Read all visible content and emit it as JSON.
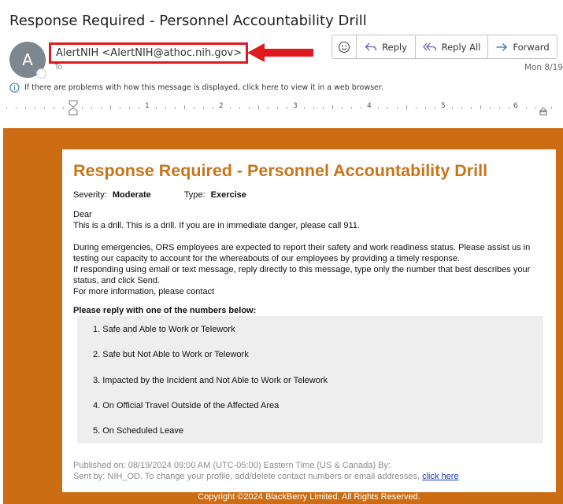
{
  "message": {
    "subject": "Response Required - Personnel Accountability Drill",
    "avatar_initial": "A",
    "sender": "AlertNIH <AlertNIH@athoc.nih.gov>",
    "to_label": "To",
    "date": "Mon 8/19",
    "info_bar": "If there are problems with how this message is displayed, click here to view it in a web browser."
  },
  "toolbar": {
    "reply_label": "Reply",
    "reply_all_label": "Reply All",
    "forward_label": "Forward"
  },
  "ruler": {
    "numbers": [
      "1",
      "2",
      "3",
      "4",
      "5",
      "6"
    ]
  },
  "email": {
    "headline": "Response Required - Personnel Accountability Drill",
    "severity_label": "Severity:",
    "severity_value": "Moderate",
    "type_label": "Type:",
    "type_value": "Exercise",
    "greeting": "Dear",
    "line1": "This is a drill. This is a drill. If you are in immediate danger, please call 911.",
    "para2": "During emergencies, ORS employees are expected to report their safety and work readiness status. Please assist us in testing our capacity to account for the whereabouts of our employees by providing a timely response.",
    "para3": "If responding using email or text message, reply directly to this message, type only the number that best describes your status, and click Send.",
    "para4": "For more information, please contact",
    "reply_title": "Please reply with one of the numbers below:",
    "options": [
      "1. Safe and Able to Work or Telework",
      "2. Safe but Not Able to Work or Telework",
      "3. Impacted by the Incident and Not Able to Work or Telework",
      "4. On Official Travel Outside of the Affected Area",
      "5. On Scheduled Leave"
    ],
    "published": "Published on: 08/19/2024 09:00 AM (UTC-05:00) Eastern Time (US & Canada) By:",
    "sent_by": "Sent by: NIH_OD. To change your profile, add/delete contact numbers or email addresses,",
    "click_here": "click here",
    "copyright": "Copyright ©2024 BlackBerry Limited. All Rights Reserved."
  },
  "colors": {
    "accent_orange": "#cc6d14",
    "headline_orange": "#c8741a",
    "annotation_red": "#e0191e",
    "link_blue": "#1a37c8"
  }
}
